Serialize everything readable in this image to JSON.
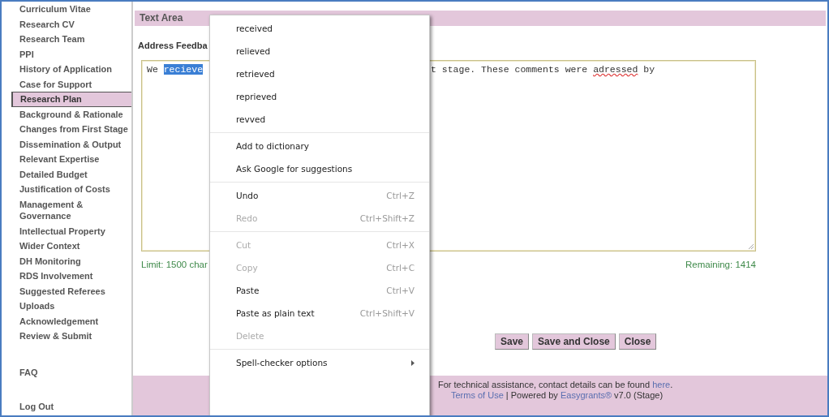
{
  "sidebar": {
    "items": [
      {
        "label": "Curriculum Vitae",
        "selected": false
      },
      {
        "label": "Research CV",
        "selected": false
      },
      {
        "label": "Research Team",
        "selected": false
      },
      {
        "label": "PPI",
        "selected": false
      },
      {
        "label": "History of Application",
        "selected": false
      },
      {
        "label": "Case for Support",
        "selected": false
      },
      {
        "label": "Research Plan",
        "selected": true
      },
      {
        "label": "Background & Rationale",
        "selected": false
      },
      {
        "label": "Changes from First Stage",
        "selected": false
      },
      {
        "label": "Dissemination & Output",
        "selected": false
      },
      {
        "label": "Relevant Expertise",
        "selected": false
      },
      {
        "label": "Detailed Budget",
        "selected": false
      },
      {
        "label": "Justification of Costs",
        "selected": false
      },
      {
        "label": "Management & Governance",
        "selected": false
      },
      {
        "label": "Intellectual Property",
        "selected": false
      },
      {
        "label": "Wider Context",
        "selected": false
      },
      {
        "label": "DH Monitoring",
        "selected": false
      },
      {
        "label": "RDS Involvement",
        "selected": false
      },
      {
        "label": "Suggested Referees",
        "selected": false
      },
      {
        "label": "Uploads",
        "selected": false
      },
      {
        "label": "Acknowledgement",
        "selected": false
      },
      {
        "label": "Review & Submit",
        "selected": false
      }
    ],
    "faq": "FAQ",
    "logout": "Log Out"
  },
  "section_bar": "Text Area",
  "field_label": "Address Feedba",
  "textarea": {
    "left": [
      {
        "text": "We ",
        "kind": "plain"
      },
      {
        "text": "recieve",
        "kind": "selected"
      }
    ],
    "right": [
      {
        "text": "t stage. These comments were ",
        "kind": "plain"
      },
      {
        "text": "adressed",
        "kind": "misspelled"
      },
      {
        "text": " by",
        "kind": "plain"
      }
    ]
  },
  "limit": "Limit: 1500 char",
  "remaining": "Remaining: 1414",
  "buttons": [
    "Save",
    "Save and Close",
    "Close"
  ],
  "footer": {
    "lines": [
      [
        {
          "text": "For technical assistance, contact details can be found ",
          "kind": "text"
        },
        {
          "text": "here",
          "kind": "link"
        },
        {
          "text": ".",
          "kind": "text"
        }
      ],
      [
        {
          "text": "Terms of Use",
          "kind": "link"
        },
        {
          "text": " | Powered by ",
          "kind": "text"
        },
        {
          "text": "Easygrants®",
          "kind": "link"
        },
        {
          "text": " v7.0 (Stage)",
          "kind": "text"
        }
      ]
    ]
  },
  "context_menu": {
    "groups": [
      {
        "items": [
          {
            "label": "received",
            "disabled": false
          },
          {
            "label": "relieved",
            "disabled": false
          },
          {
            "label": "retrieved",
            "disabled": false
          },
          {
            "label": "reprieved",
            "disabled": false
          },
          {
            "label": "revved",
            "disabled": false
          }
        ]
      },
      {
        "items": [
          {
            "label": "Add to dictionary",
            "disabled": false
          },
          {
            "label": "Ask Google for suggestions",
            "disabled": false
          }
        ]
      },
      {
        "items": [
          {
            "label": "Undo",
            "shortcut": "Ctrl+Z",
            "disabled": false
          },
          {
            "label": "Redo",
            "shortcut": "Ctrl+Shift+Z",
            "disabled": true
          }
        ]
      },
      {
        "items": [
          {
            "label": "Cut",
            "shortcut": "Ctrl+X",
            "disabled": true
          },
          {
            "label": "Copy",
            "shortcut": "Ctrl+C",
            "disabled": true
          },
          {
            "label": "Paste",
            "shortcut": "Ctrl+V",
            "disabled": false
          },
          {
            "label": "Paste as plain text",
            "shortcut": "Ctrl+Shift+V",
            "disabled": false
          },
          {
            "label": "Delete",
            "disabled": true
          }
        ]
      },
      {
        "items": [
          {
            "label": "Spell-checker options",
            "disabled": false,
            "submenu": true
          }
        ]
      }
    ]
  }
}
